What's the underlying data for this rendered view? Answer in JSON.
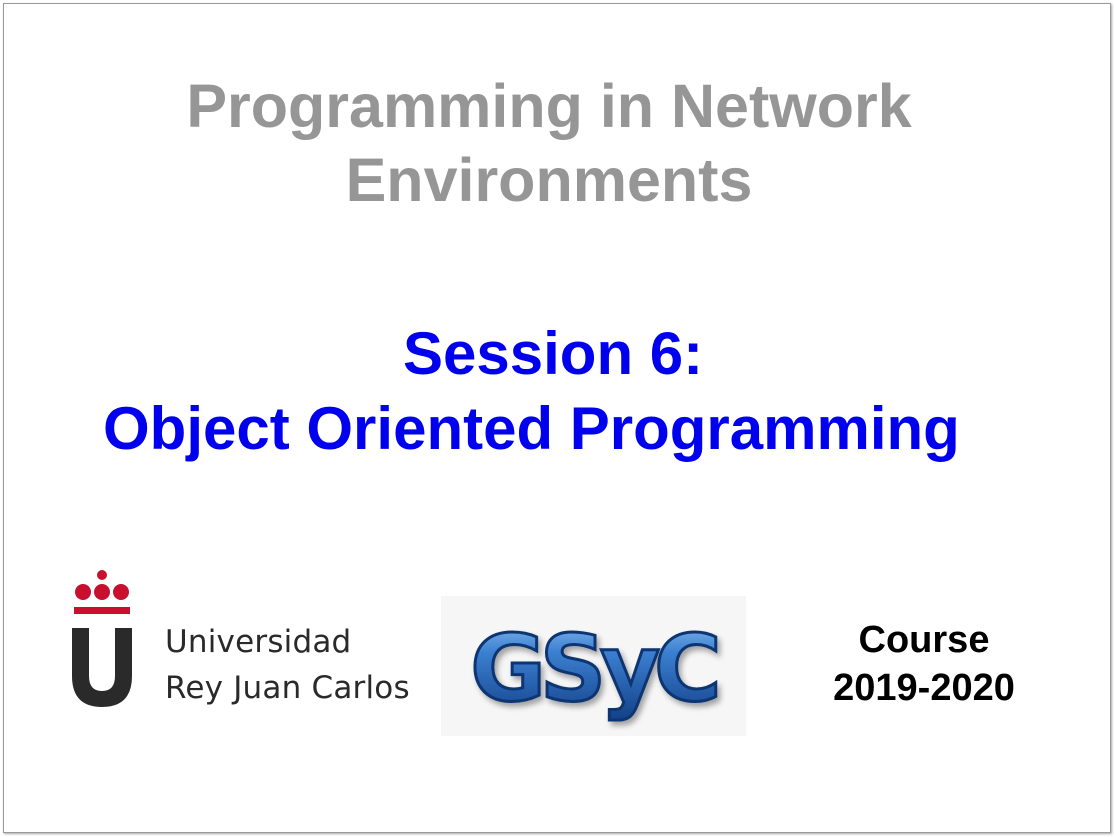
{
  "slide": {
    "title_line1": "Programming in Network",
    "title_line2": "Environments",
    "session_line1": "Session 6:",
    "session_line2": "Object Oriented Programming",
    "university_line1": "Universidad",
    "university_line2": "Rey Juan Carlos",
    "group_logo_text": "GSyC",
    "course_line1": "Course",
    "course_line2": "2019-2020"
  },
  "colors": {
    "title": "#969696",
    "session": "#0000ee",
    "urjc_red": "#c8102e",
    "urjc_dark": "#2a2a2a",
    "gsyc_blue": "#1f5aa8"
  },
  "icons": [
    "urjc-logo-icon",
    "gsyc-logo-icon"
  ]
}
